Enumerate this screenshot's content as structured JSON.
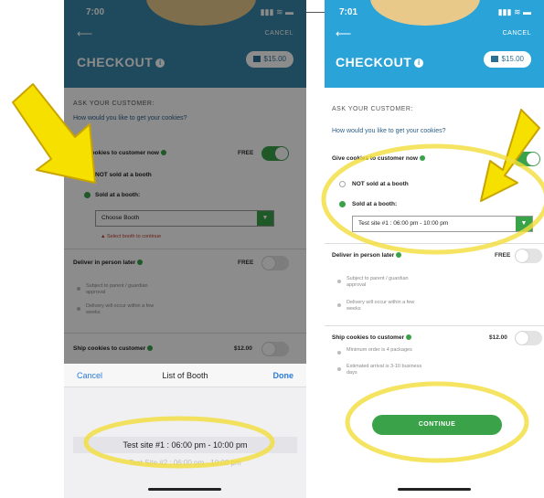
{
  "left": {
    "time": "7:00",
    "cancel": "CANCEL",
    "title": "CHECKOUT",
    "cart_total": "$15.00",
    "ask": "ASK YOUR CUSTOMER:",
    "question": "How would you like to get your cookies?",
    "give_now": "Give cookies to customer now",
    "give_now_price": "FREE",
    "not_booth": "NOT sold at a booth",
    "sold_booth": "Sold at a booth:",
    "choose_booth": "Choose Booth",
    "warning": "Select booth to continue",
    "deliver": "Deliver in person later",
    "deliver_price": "FREE",
    "deliver_sub1": "Subject to parent / guardian approval",
    "deliver_sub2": "Delivery will occur within a few weeks",
    "ship": "Ship cookies to customer",
    "ship_price": "$12.00",
    "picker_cancel": "Cancel",
    "picker_title": "List of Booth",
    "picker_done": "Done",
    "option1": "Test site #1 : 06:00 pm - 10:00 pm",
    "option2": "Test Site #2 : 06:00 pm - 10:00 pm"
  },
  "right": {
    "time": "7:01",
    "cancel": "CANCEL",
    "title": "CHECKOUT",
    "cart_total": "$15.00",
    "ask": "ASK YOUR CUSTOMER:",
    "question": "How would you like to get your cookies?",
    "give_now": "Give cookies to customer now",
    "not_booth": "NOT sold at a booth",
    "sold_booth": "Sold at a booth:",
    "selected_booth": "Test site #1 : 06:00 pm - 10:00 pm",
    "deliver": "Deliver in person later",
    "deliver_price": "FREE",
    "deliver_sub1": "Subject to parent / guardian approval",
    "deliver_sub2": "Delivery will occur within a few weeks",
    "ship": "Ship cookies to customer",
    "ship_price": "$12.00",
    "ship_sub1": "Minimum order is 4 packages",
    "ship_sub2": "Estimated arrival is 3-10 business days",
    "continue": "CONTINUE"
  },
  "colors": {
    "header_blue": "#2aa3d8",
    "accent_green": "#3aa34a",
    "highlight_yellow": "#f2dd3a",
    "arrow_yellow": "#f5e000"
  }
}
